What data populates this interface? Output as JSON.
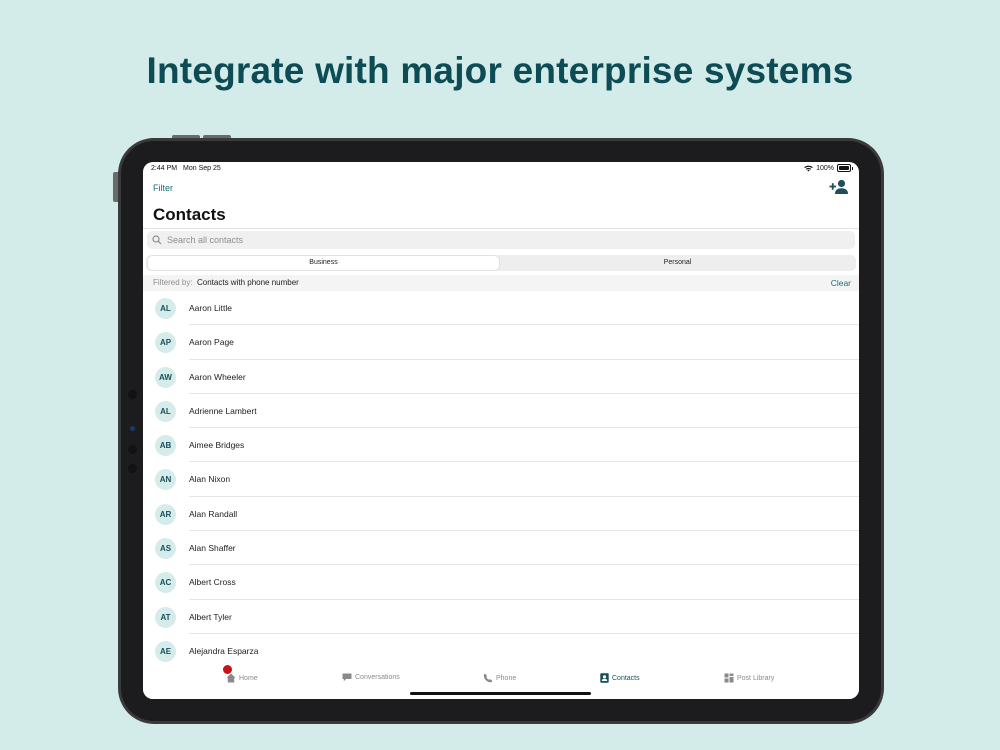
{
  "headline": "Integrate with major enterprise systems",
  "status_bar": {
    "time": "2:44 PM",
    "date": "Mon Sep 25",
    "battery": "100%"
  },
  "header": {
    "filter_label": "Filter",
    "title": "Contacts"
  },
  "search": {
    "placeholder": "Search all contacts"
  },
  "segments": [
    {
      "label": "Business",
      "selected": true
    },
    {
      "label": "Personal",
      "selected": false
    }
  ],
  "filter_bar": {
    "label": "Filtered by:",
    "value": "Contacts with phone number",
    "clear_label": "Clear"
  },
  "contacts": [
    {
      "initials": "AL",
      "name": "Aaron Little"
    },
    {
      "initials": "AP",
      "name": "Aaron Page"
    },
    {
      "initials": "AW",
      "name": "Aaron Wheeler"
    },
    {
      "initials": "AL",
      "name": "Adrienne Lambert"
    },
    {
      "initials": "AB",
      "name": "Aimee Bridges"
    },
    {
      "initials": "AN",
      "name": "Alan Nixon"
    },
    {
      "initials": "AR",
      "name": "Alan Randall"
    },
    {
      "initials": "AS",
      "name": "Alan Shaffer"
    },
    {
      "initials": "AC",
      "name": "Albert Cross"
    },
    {
      "initials": "AT",
      "name": "Albert Tyler"
    },
    {
      "initials": "AE",
      "name": "Alejandra Esparza"
    }
  ],
  "tabs": [
    {
      "label": "Home",
      "icon": "home-icon"
    },
    {
      "label": "Conversations",
      "icon": "chat-bubble-icon"
    },
    {
      "label": "Phone",
      "icon": "phone-icon"
    },
    {
      "label": "Contacts",
      "icon": "contact-card-icon",
      "active": true
    },
    {
      "label": "Post Library",
      "icon": "grid-icon"
    }
  ],
  "colors": {
    "background": "#d3ece9",
    "headline": "#0d4b55",
    "accent": "#1f6c78",
    "avatar_bg": "#d6ecea",
    "badge": "#c61313"
  }
}
